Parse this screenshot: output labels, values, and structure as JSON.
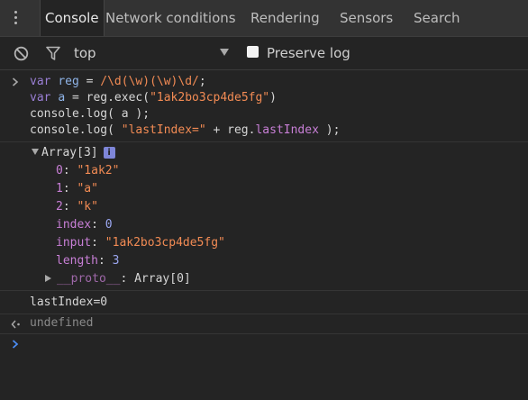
{
  "tabs": {
    "console": "Console",
    "network_conditions": "Network conditions",
    "rendering": "Rendering",
    "sensors": "Sensors",
    "search": "Search"
  },
  "toolbar": {
    "context": "top",
    "preserve_log": "Preserve log",
    "preserve_log_checked": false
  },
  "input_code": {
    "line1": {
      "kw": "var",
      "name": "reg",
      "eq": " = ",
      "regex": "/\\d(\\w)(\\w)\\d/",
      "end": ";"
    },
    "line2": {
      "kw": "var",
      "name": "a",
      "eq": " = ",
      "obj": "reg",
      "method": ".exec(",
      "arg": "\"1ak2bo3cp4de5fg\"",
      "end": ")"
    },
    "line3": {
      "text": "console.log( a );"
    },
    "line4": {
      "pre": "console.log( ",
      "arg": "\"lastIndex=\"",
      "plus": " + ",
      "obj": "reg",
      "dot": ".",
      "prop": "lastIndex",
      "end": " );"
    }
  },
  "output": {
    "array_header": "Array[3]",
    "info_badge": "i",
    "items": [
      {
        "key": "0",
        "value": "\"1ak2\""
      },
      {
        "key": "1",
        "value": "\"a\""
      },
      {
        "key": "2",
        "value": "\"k\""
      }
    ],
    "index_key": "index",
    "index_value": "0",
    "input_key": "input",
    "input_value": "\"1ak2bo3cp4de5fg\"",
    "length_key": "length",
    "length_value": "3",
    "proto_key": "__proto__",
    "proto_value": "Array[0]",
    "log_line": "lastIndex=0",
    "return_value": "undefined"
  },
  "colors": {
    "background": "#242424",
    "tabbar": "#333333",
    "string": "#f28b54",
    "keyword": "#9a7fd5",
    "property": "#c87fd6",
    "number": "#9ba7f1",
    "prompt_active": "#4c8ef5"
  },
  "icons": {
    "menu": "kebab-menu-icon",
    "clear": "clear-console-icon",
    "filter": "filter-icon",
    "dropdown": "dropdown-arrow-icon",
    "input_prompt": "input-prompt-icon",
    "result_prompt": "result-arrow-icon",
    "expand": "expand-triangle-icon",
    "collapse": "collapsed-triangle-icon",
    "info": "info-icon"
  }
}
